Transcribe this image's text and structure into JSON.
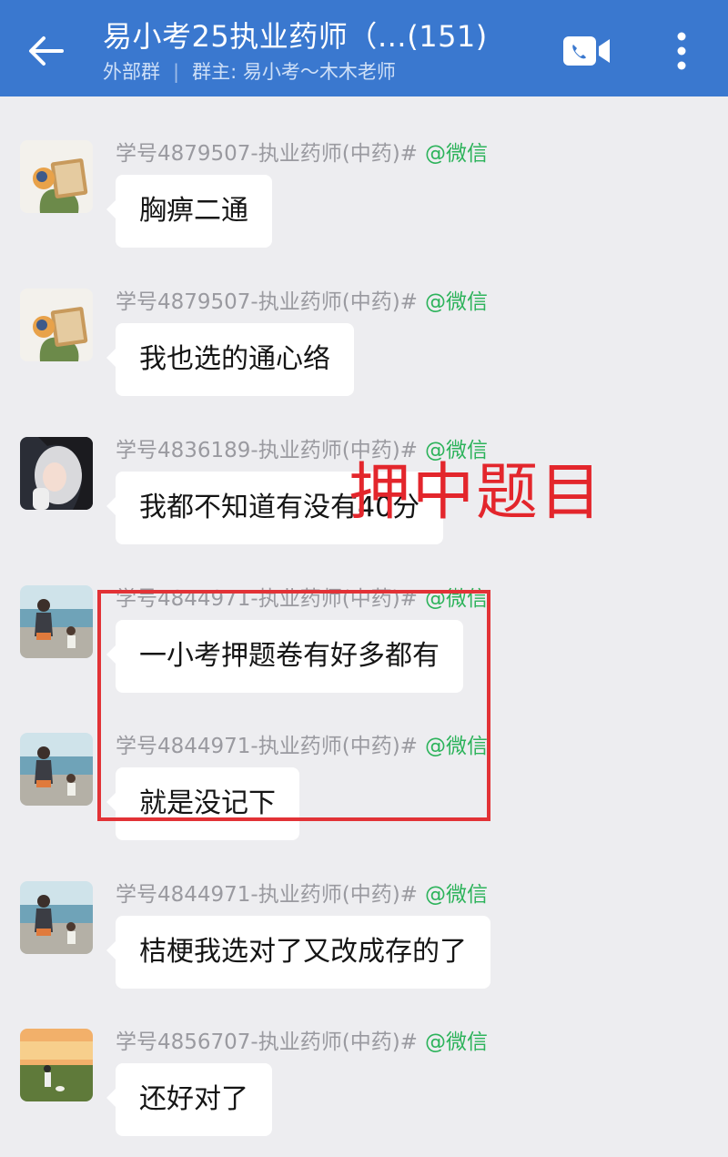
{
  "header": {
    "title": "易小考25执业药师（…(151)",
    "group_type": "外部群",
    "owner": "群主: 易小考～木木老师",
    "colors": {
      "bar": "#3a78cf"
    }
  },
  "messages": [
    {
      "sender": "学号4879507-执业药师(中药)#",
      "tag": "@微信",
      "text": "胸痹二通",
      "avatar": "avatar-book-reader"
    },
    {
      "sender": "学号4879507-执业药师(中药)#",
      "tag": "@微信",
      "text": "我也选的通心络",
      "avatar": "avatar-book-reader"
    },
    {
      "sender": "学号4836189-执业药师(中药)#",
      "tag": "@微信",
      "text": "我都不知道有没有40分",
      "avatar": "avatar-girl-photo"
    },
    {
      "sender": "学号4844971-执业药师(中药)#",
      "tag": "@微信",
      "text": "一小考押题卷有好多都有",
      "avatar": "avatar-seaside-illustration"
    },
    {
      "sender": "学号4844971-执业药师(中药)#",
      "tag": "@微信",
      "text": "就是没记下",
      "avatar": "avatar-seaside-illustration"
    },
    {
      "sender": "学号4844971-执业药师(中药)#",
      "tag": "@微信",
      "text": "桔梗我选对了又改成存的了",
      "avatar": "avatar-seaside-illustration"
    },
    {
      "sender": "学号4856707-执业药师(中药)#",
      "tag": "@微信",
      "text": "还好对了",
      "avatar": "avatar-sunset-field"
    }
  ],
  "annotation": {
    "text": "押中题目",
    "color": "#e3262c"
  }
}
